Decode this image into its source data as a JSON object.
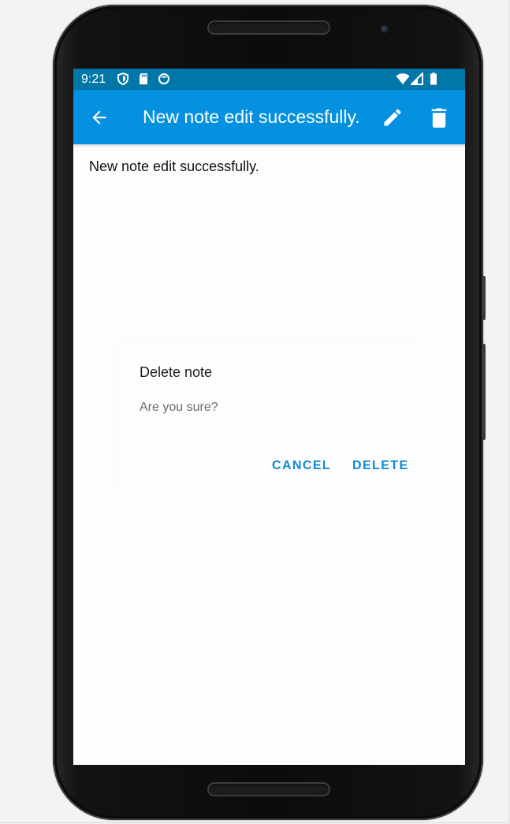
{
  "status_bar": {
    "time": "9:21",
    "icons": [
      "shield-icon",
      "sd-card-icon",
      "sync-icon",
      "wifi-icon",
      "signal-icon",
      "battery-icon"
    ],
    "color": "#0177a8"
  },
  "app_bar": {
    "title": "New note edit successfully.",
    "back_icon": "arrow-left-icon",
    "edit_icon": "pencil-icon",
    "delete_icon": "trash-icon",
    "color": "#0391e0"
  },
  "note": {
    "body": "New note edit successfully."
  },
  "dialog": {
    "title": "Delete note",
    "message": "Are you sure?",
    "cancel_label": "CANCEL",
    "delete_label": "DELETE",
    "accent": "#0c8ad8"
  }
}
